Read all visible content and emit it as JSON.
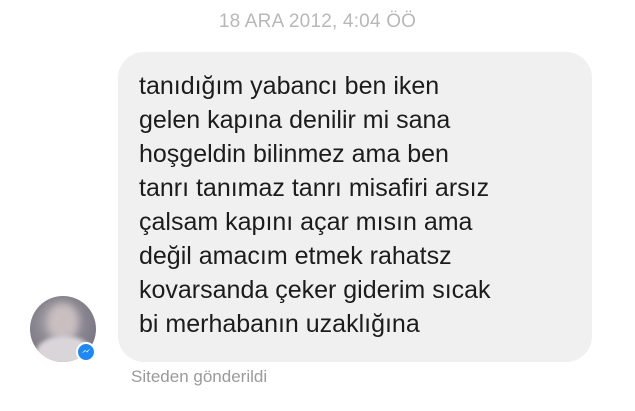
{
  "conversation": {
    "timestamp": "18 ARA 2012, 4:04 ÖÖ"
  },
  "message": {
    "lines": [
      "tanıdığım yabancı ben iken",
      "gelen kapına denilir mi sana",
      "hoşgeldin bilinmez ama ben",
      "tanrı tanımaz tanrı misafiri arsız",
      "çalsam kapını açar mısın ama",
      "değil amacım etmek rahatsz",
      "kovarsanda çeker giderim sıcak",
      "bi merhabanın uzaklığına"
    ],
    "bubble_color": "#f1f0f0",
    "text_color": "#1c1c1c"
  },
  "sender": {
    "avatar_icon": "profile-photo",
    "badge_icon": "messenger-icon",
    "badge_color": "#1e88f5"
  },
  "footer": {
    "source_text": "Siteden gönderildi"
  }
}
